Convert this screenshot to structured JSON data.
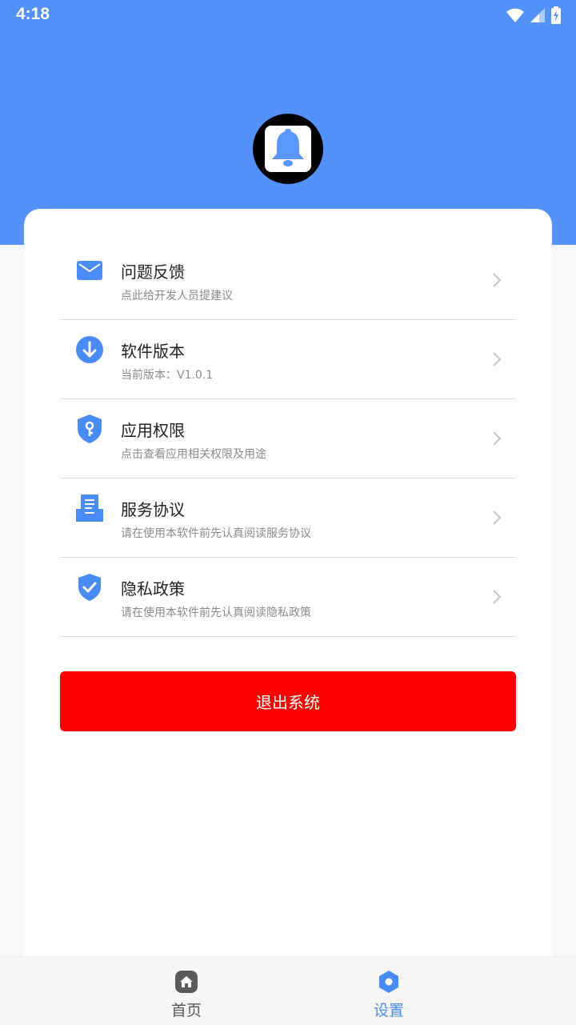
{
  "status_bar": {
    "time": "4:18"
  },
  "menu": {
    "items": [
      {
        "title": "问题反馈",
        "subtitle": "点此给开发人员提建议",
        "icon": "mail-icon"
      },
      {
        "title": "软件版本",
        "subtitle": "当前版本：V1.0.1",
        "icon": "download-icon"
      },
      {
        "title": "应用权限",
        "subtitle": "点击查看应用相关权限及用途",
        "icon": "shield-key-icon"
      },
      {
        "title": "服务协议",
        "subtitle": "请在使用本软件前先认真阅读服务协议",
        "icon": "document-tray-icon"
      },
      {
        "title": "隐私政策",
        "subtitle": "请在使用本软件前先认真阅读隐私政策",
        "icon": "shield-check-icon"
      }
    ]
  },
  "logout_label": "退出系统",
  "bottom_nav": {
    "home_label": "首页",
    "settings_label": "设置",
    "active": "settings"
  },
  "colors": {
    "primary": "#5391fb",
    "danger": "#ff0000",
    "inactive_nav": "#555555"
  }
}
